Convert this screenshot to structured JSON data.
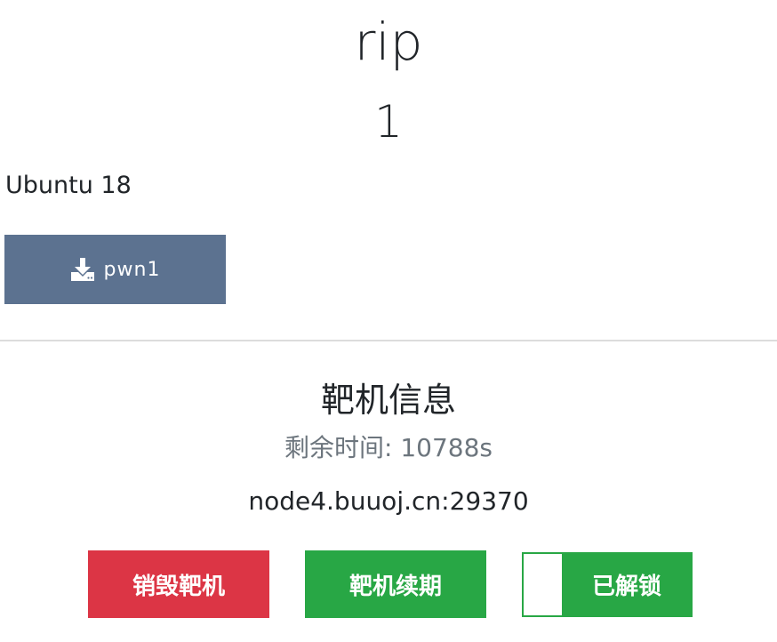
{
  "challenge": {
    "title": "rip",
    "points": "1",
    "description": "Ubuntu 18",
    "download_label": "pwn1"
  },
  "instance": {
    "heading": "靶机信息",
    "remaining_time": "剩余时间: 10788s",
    "address": "node4.buuoj.cn:29370"
  },
  "actions": {
    "destroy_label": "销毁靶机",
    "renew_label": "靶机续期",
    "unlocked_label": "已解锁"
  },
  "colors": {
    "download_button": "#5c7290",
    "destroy_button": "#dc3545",
    "renew_button": "#28a745",
    "muted_text": "#6c757d"
  },
  "icons": {
    "download": "download-icon"
  }
}
